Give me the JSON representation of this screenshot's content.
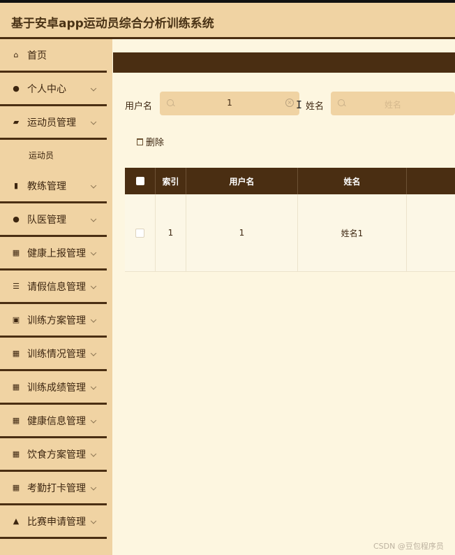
{
  "app": {
    "title": "基于安卓app运动员综合分析训练系统"
  },
  "sidebar": {
    "items": [
      {
        "label": "首页",
        "icon": "home-icon",
        "glyph": "⌂",
        "has_chevron": false
      },
      {
        "label": "个人中心",
        "icon": "user-icon",
        "glyph": "●",
        "has_chevron": true
      },
      {
        "label": "运动员管理",
        "icon": "wallet-icon",
        "glyph": "▰",
        "has_chevron": true
      },
      {
        "label": "运动员",
        "sub": true
      },
      {
        "label": "教练管理",
        "icon": "book-icon",
        "glyph": "▮",
        "has_chevron": true
      },
      {
        "label": "队医管理",
        "icon": "user-icon",
        "glyph": "●",
        "has_chevron": true
      },
      {
        "label": "健康上报管理",
        "icon": "grid-icon",
        "glyph": "▦",
        "has_chevron": true
      },
      {
        "label": "请假信息管理",
        "icon": "list-icon",
        "glyph": "☰",
        "has_chevron": true
      },
      {
        "label": "训练方案管理",
        "icon": "clipboard-icon",
        "glyph": "▣",
        "has_chevron": true
      },
      {
        "label": "训练情况管理",
        "icon": "grid-icon",
        "glyph": "▦",
        "has_chevron": true
      },
      {
        "label": "训练成绩管理",
        "icon": "grid-icon",
        "glyph": "▦",
        "has_chevron": true
      },
      {
        "label": "健康信息管理",
        "icon": "grid-icon",
        "glyph": "▦",
        "has_chevron": true
      },
      {
        "label": "饮食方案管理",
        "icon": "apps-icon",
        "glyph": "▦",
        "has_chevron": true
      },
      {
        "label": "考勤打卡管理",
        "icon": "grid-icon",
        "glyph": "▦",
        "has_chevron": true
      },
      {
        "label": "比赛申请管理",
        "icon": "user-icon",
        "glyph": "▲",
        "has_chevron": true
      }
    ]
  },
  "search": {
    "username_label": "用户名",
    "username_value": "1",
    "name_label": "姓名",
    "name_placeholder": "姓名"
  },
  "toolbar": {
    "delete_label": "删除"
  },
  "table": {
    "headers": [
      "索引",
      "用户名",
      "姓名"
    ],
    "rows": [
      {
        "index": "1",
        "username": "1",
        "name": "姓名1"
      }
    ]
  },
  "watermark": "CSDN @豆包程序员",
  "colors": {
    "accent": "#4a2e12",
    "sidebar_bg": "#f0d3a3",
    "content_bg": "#fdf6e0"
  }
}
